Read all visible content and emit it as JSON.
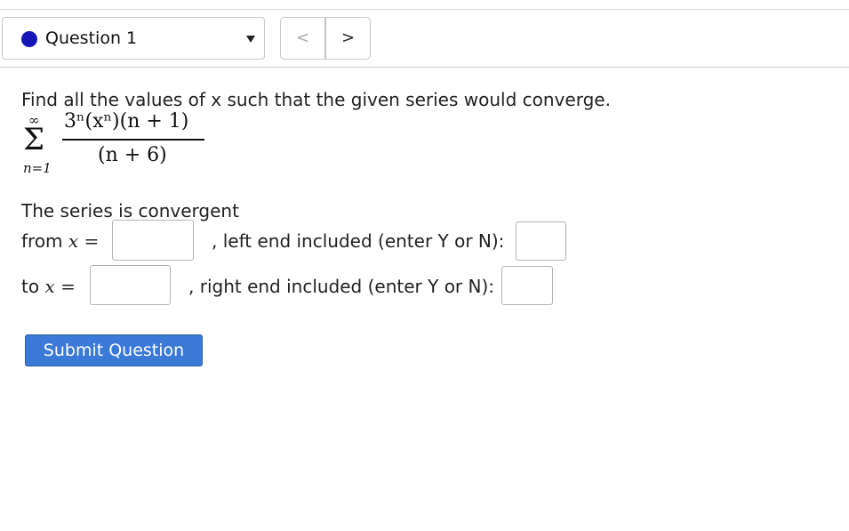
{
  "question_nav": {
    "label": "Question 1",
    "prev_glyph": "<",
    "next_glyph": ">",
    "status_color": "#1616b8"
  },
  "problem": {
    "prompt": "Find all the values of x such that the given series would converge.",
    "sum_upper": "∞",
    "sum_lower": "n=1",
    "numerator": "3ⁿ(xⁿ)(n + 1)",
    "denominator": "(n + 6)"
  },
  "answer": {
    "statement": "The series is convergent",
    "from_label": "from",
    "to_label": "to",
    "variable": "x",
    "equals": "=",
    "from_value": "",
    "to_value": "",
    "left_end_label": ", left end included (enter Y or N):",
    "right_end_label": ", right end included (enter Y or N):",
    "left_end_value": "",
    "right_end_value": ""
  },
  "submit_label": "Submit Question",
  "colors": {
    "submit_bg": "#3a79d6",
    "status_dot": "#1616b8"
  }
}
